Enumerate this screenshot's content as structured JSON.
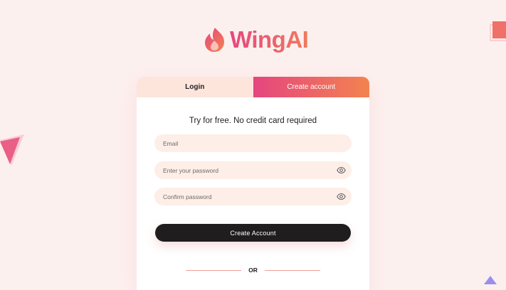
{
  "brand": {
    "name": "WingAI",
    "gradient_start": "#e5457f",
    "gradient_end": "#f3834f"
  },
  "tabs": [
    {
      "label": "Login",
      "active": false
    },
    {
      "label": "Create account",
      "active": true
    }
  ],
  "form": {
    "tagline": "Try for free. No credit card required",
    "email_placeholder": "Email",
    "password_placeholder": "Enter your password",
    "confirm_placeholder": "Confirm password",
    "submit_label": "Create Account",
    "divider_text": "OR"
  },
  "icons": {
    "logo": "flame-icon",
    "password_toggle": "eye-icon",
    "confirm_toggle": "eye-icon"
  },
  "colors": {
    "background": "#fcf0ef",
    "field_bg": "#fdeee7",
    "button_bg": "#1f1d1d",
    "login_tab_bg": "#fde5dc"
  }
}
